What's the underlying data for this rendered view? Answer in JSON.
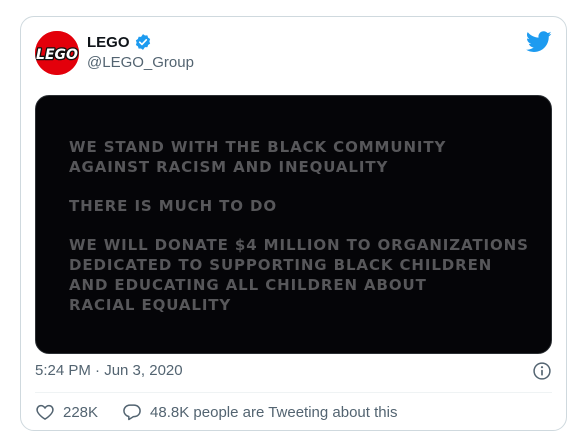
{
  "tweet": {
    "author": {
      "display_name": "LEGO",
      "handle": "@LEGO_Group",
      "verified": true,
      "avatar_logo_text": "LEGO"
    },
    "image_text": {
      "line1": "WE STAND WITH THE BLACK COMMUNITY",
      "line2": "AGAINST RACISM AND INEQUALITY",
      "line3": "THERE IS MUCH TO DO",
      "line4": "WE WILL DONATE $4 MILLION TO ORGANIZATIONS",
      "line5": "DEDICATED TO SUPPORTING BLACK CHILDREN",
      "line6": "AND EDUCATING ALL CHILDREN ABOUT",
      "line7": "RACIAL EQUALITY"
    },
    "timestamp": "5:24 PM · Jun 3, 2020",
    "likes": "228K",
    "discussion": "48.8K people are Tweeting about this"
  },
  "icons": {
    "brand": "twitter-bird-icon",
    "verified": "verified-badge-icon",
    "info": "info-icon",
    "like": "heart-icon",
    "reply": "speech-bubble-icon"
  },
  "colors": {
    "twitter_blue": "#1d9bf0",
    "lego_red": "#e3000b",
    "lego_yellow": "#ffd500",
    "image_background": "#050508",
    "image_text": "#57575a",
    "secondary_text": "#536471"
  }
}
